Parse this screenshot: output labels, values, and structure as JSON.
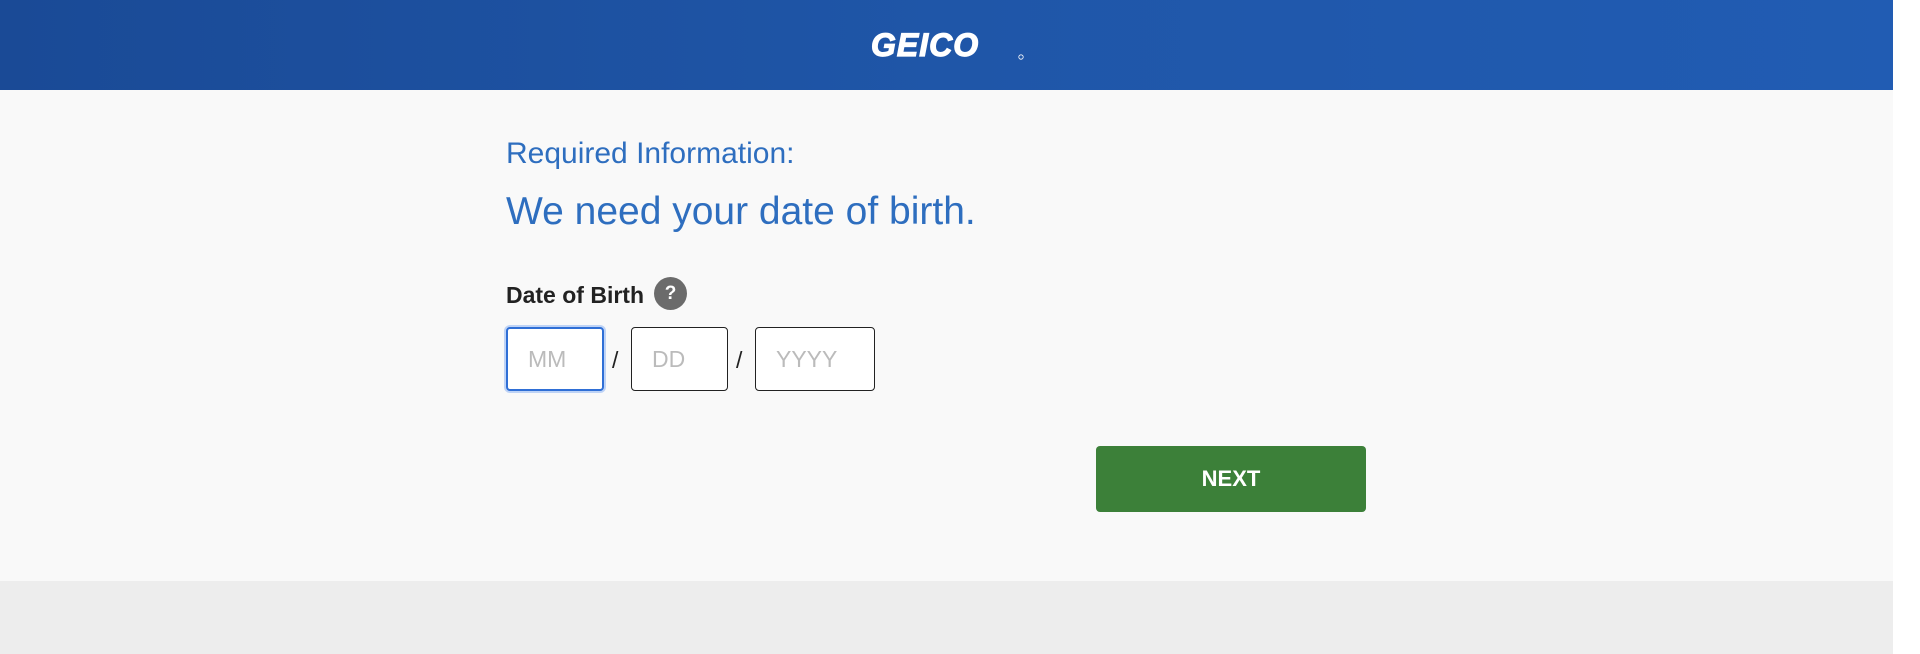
{
  "header": {
    "logo_text": "GEICO"
  },
  "form": {
    "required_label": "Required Information:",
    "headline": "We need your date of birth.",
    "dob_label": "Date of Birth",
    "help_icon_text": "?",
    "help_icon": "question-icon",
    "separator": "/",
    "month": {
      "placeholder": "MM",
      "value": ""
    },
    "day": {
      "placeholder": "DD",
      "value": ""
    },
    "year": {
      "placeholder": "YYYY",
      "value": ""
    },
    "next_label": "NEXT"
  },
  "colors": {
    "header_blue": "#1f56a8",
    "heading_blue": "#2e6ebf",
    "next_green": "#3c8039",
    "focus_blue": "#2f6fd6"
  }
}
